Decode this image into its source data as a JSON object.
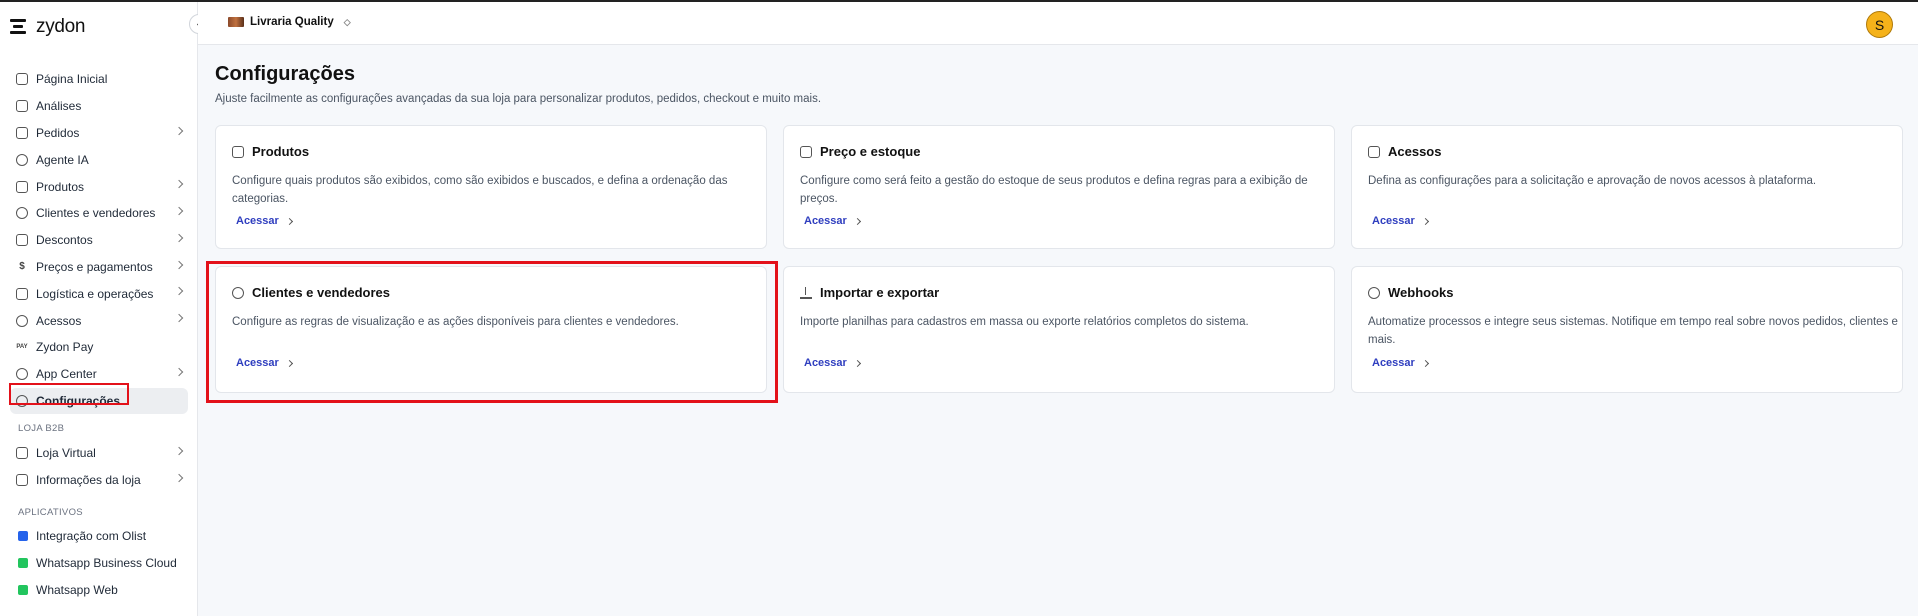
{
  "app": {
    "logo_text": "zydon"
  },
  "header": {
    "store_name": "Livraria Quality",
    "store_selector": "◇",
    "avatar_letter": "S"
  },
  "sidebar": {
    "items": [
      {
        "label": "Página Inicial"
      },
      {
        "label": "Análises"
      },
      {
        "label": "Pedidos"
      },
      {
        "label": "Agente IA"
      },
      {
        "label": "Produtos"
      },
      {
        "label": "Clientes e vendedores"
      },
      {
        "label": "Descontos"
      },
      {
        "label": "Preços e pagamentos"
      },
      {
        "label": "Logística e operações"
      },
      {
        "label": "Acessos"
      },
      {
        "label": "Zydon Pay"
      },
      {
        "label": "App Center"
      },
      {
        "label": "Configurações"
      }
    ],
    "section_b2b": "LOJA B2B",
    "b2b_items": [
      {
        "label": "Loja Virtual"
      },
      {
        "label": "Informações da loja"
      }
    ],
    "section_apps": "APLICATIVOS",
    "apps": [
      {
        "label": "Integração com Olist",
        "color": "#2563eb"
      },
      {
        "label": "Whatsapp Business Cloud",
        "color": "#22c55e"
      },
      {
        "label": "Whatsapp Web",
        "color": "#22c55e"
      }
    ]
  },
  "main": {
    "title": "Configurações",
    "subtitle": "Ajuste facilmente as configurações avançadas da sua loja para personalizar produtos, pedidos, checkout e muito mais.",
    "cards": [
      {
        "title": "Produtos",
        "description": "Configure quais produtos são exibidos, como são exibidos e buscados, e defina a ordenação das categorias.",
        "link": "Acessar"
      },
      {
        "title": "Preço e estoque",
        "description": "Configure como será feito a gestão do estoque de seus produtos e defina regras para a exibição de preços.",
        "link": "Acessar"
      },
      {
        "title": "Acessos",
        "description": "Defina as configurações para a solicitação e aprovação de novos acessos à plataforma.",
        "link": "Acessar"
      },
      {
        "title": "Clientes e vendedores",
        "description": "Configure as regras de visualização e as ações disponíveis para clientes e vendedores.",
        "link": "Acessar"
      },
      {
        "title": "Importar e exportar",
        "description": "Importe planilhas para cadastros em massa ou exporte relatórios completos do sistema.",
        "link": "Acessar"
      },
      {
        "title": "Webhooks",
        "description": "Automatize processos e integre seus sistemas. Notifique em tempo real sobre novos pedidos, clientes e mais.",
        "link": "Acessar"
      }
    ]
  },
  "colors": {
    "accent_link": "#2f3ebf",
    "highlight": "#e3111a",
    "avatar_bg": "#f5b21a"
  }
}
